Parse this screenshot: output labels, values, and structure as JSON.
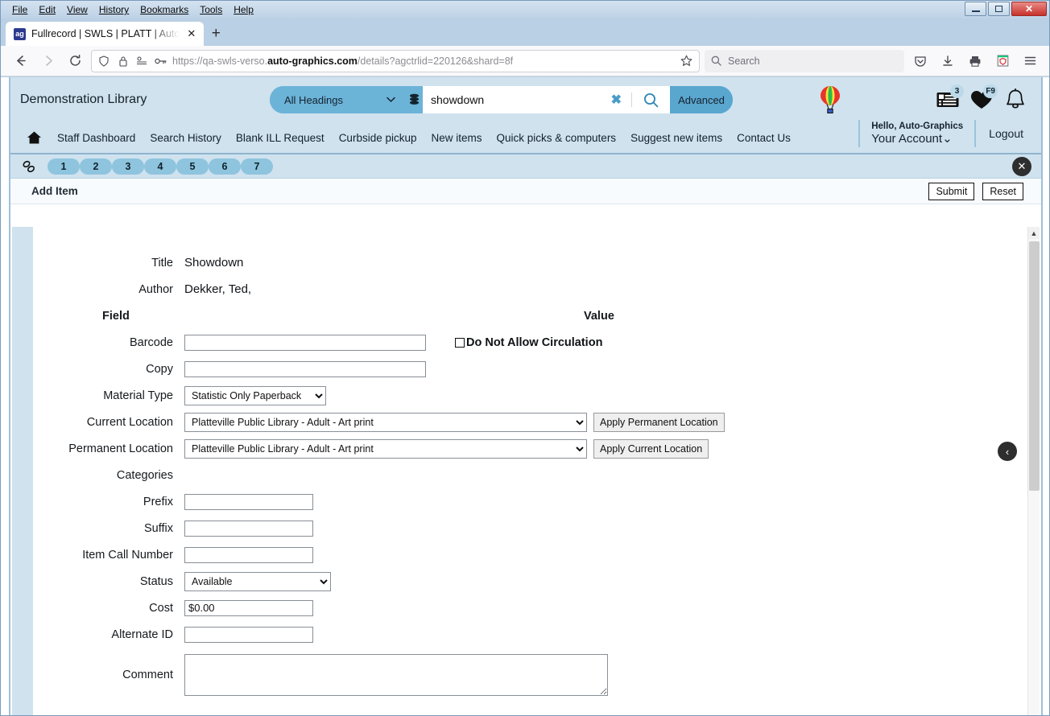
{
  "browser": {
    "menus": [
      "File",
      "Edit",
      "View",
      "History",
      "Bookmarks",
      "Tools",
      "Help"
    ],
    "window_buttons": {
      "minimize": "minimize-icon",
      "maximize": "maximize-icon",
      "close": "✕"
    },
    "tab": {
      "title": "Fullrecord | SWLS | PLATT | Auto",
      "favicon": "ag-logo-icon",
      "close_label": "✕",
      "newtab_label": "+"
    },
    "toolbar": {
      "back": "back-arrow-icon",
      "forward": "forward-arrow-icon",
      "reload": "reload-icon",
      "url_prefix": "https://qa-swls-verso.",
      "url_domain": "auto-graphics.com",
      "url_suffix": "/details?agctrlid=220126&shard=8f",
      "bookmark": "star-icon",
      "search_placeholder": "Search",
      "icons": [
        "shield-icon",
        "lock-icon",
        "reader-icon",
        "key-icon",
        "pocket-icon",
        "download-icon",
        "print-icon",
        "extension-icon",
        "hamburger-menu-icon"
      ]
    }
  },
  "app": {
    "library_name": "Demonstration Library",
    "search": {
      "scope": "All Headings",
      "query": "showdown",
      "clear_label": "✖",
      "advanced_label": "Advanced"
    },
    "header_icons": [
      {
        "name": "list-icon",
        "badge": "3"
      },
      {
        "name": "heart-icon",
        "badge": "F9"
      },
      {
        "name": "bell-icon",
        "badge": ""
      }
    ],
    "nav_links": [
      "Staff Dashboard",
      "Search History",
      "Blank ILL Request",
      "Curbside pickup",
      "New items",
      "Quick picks & computers",
      "Suggest new items",
      "Contact Us"
    ],
    "account": {
      "hello": "Hello, Auto-Graphics",
      "name": "Your Account",
      "caret": "⌄",
      "logout": "Logout"
    },
    "steps": [
      "1",
      "2",
      "3",
      "4",
      "5",
      "6",
      "7"
    ],
    "close_panel_label": "✕",
    "collapse_label": "‹"
  },
  "form": {
    "title": "Add Item",
    "submit_label": "Submit",
    "reset_label": "Reset",
    "record": {
      "title_label": "Title",
      "title_value": "Showdown",
      "author_label": "Author",
      "author_value": "Dekker, Ted,"
    },
    "column_headers": {
      "field": "Field",
      "value": "Value"
    },
    "fields": {
      "barcode_label": "Barcode",
      "barcode_value": "",
      "no_circ_label": "Do Not Allow Circulation",
      "copy_label": "Copy",
      "copy_value": "",
      "material_type_label": "Material Type",
      "material_type_value": "Statistic Only Paperback",
      "current_location_label": "Current Location",
      "current_location_value": "Platteville Public Library - Adult - Art print",
      "apply_permanent_label": "Apply Permanent Location",
      "permanent_location_label": "Permanent Location",
      "permanent_location_value": "Platteville Public Library - Adult - Art print",
      "apply_current_label": "Apply Current Location",
      "categories_label": "Categories",
      "prefix_label": "Prefix",
      "prefix_value": "",
      "suffix_label": "Suffix",
      "suffix_value": "",
      "call_number_label": "Item Call Number",
      "call_number_value": "",
      "status_label": "Status",
      "status_value": "Available",
      "cost_label": "Cost",
      "cost_value": "$0.00",
      "alternate_id_label": "Alternate ID",
      "alternate_id_value": "",
      "comment_label": "Comment",
      "comment_value": ""
    }
  },
  "colors": {
    "header_blue": "#cfe2ee",
    "accent_blue": "#6cb3d8",
    "step_blue": "#8ec4de",
    "advanced_blue": "#59a6cf"
  }
}
